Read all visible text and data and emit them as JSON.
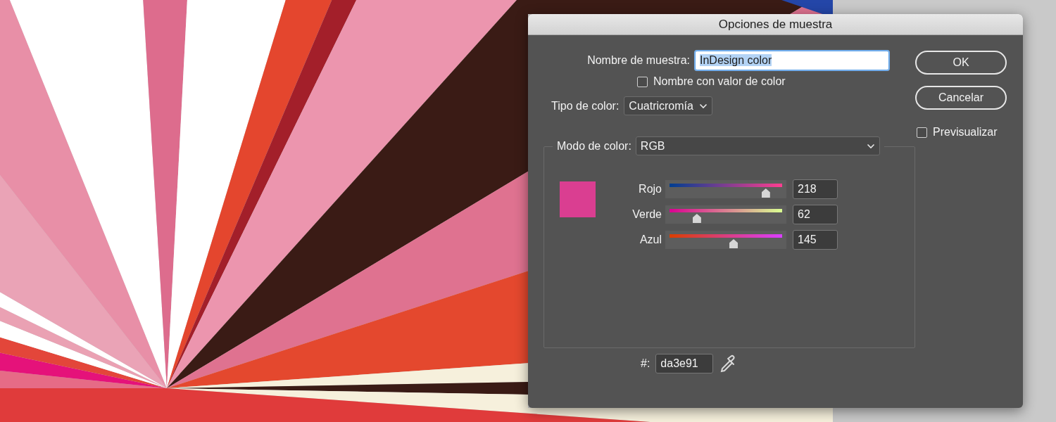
{
  "window": {
    "title": "Opciones de muestra"
  },
  "swatch_name": {
    "label": "Nombre de muestra:",
    "value": "InDesign color",
    "text_selected": true
  },
  "name_with_value": {
    "label": "Nombre con valor de color",
    "checked": false
  },
  "color_type": {
    "label": "Tipo de color:",
    "value": "Cuatricromía"
  },
  "color_mode": {
    "label": "Modo de color:",
    "value": "RGB"
  },
  "preview": {
    "color": "#da3e91"
  },
  "channels": [
    {
      "label": "Rojo",
      "level": 0.855,
      "value": "218"
    },
    {
      "label": "Verde",
      "level": 0.243,
      "value": "62"
    },
    {
      "label": "Azul",
      "level": 0.569,
      "value": "145"
    }
  ],
  "hex": {
    "label": "#:",
    "value": "da3e91"
  },
  "buttons": [
    {
      "label": "OK"
    },
    {
      "label": "Cancelar"
    }
  ],
  "preview_checkbox": {
    "label": "Previsualizar",
    "checked": false
  }
}
